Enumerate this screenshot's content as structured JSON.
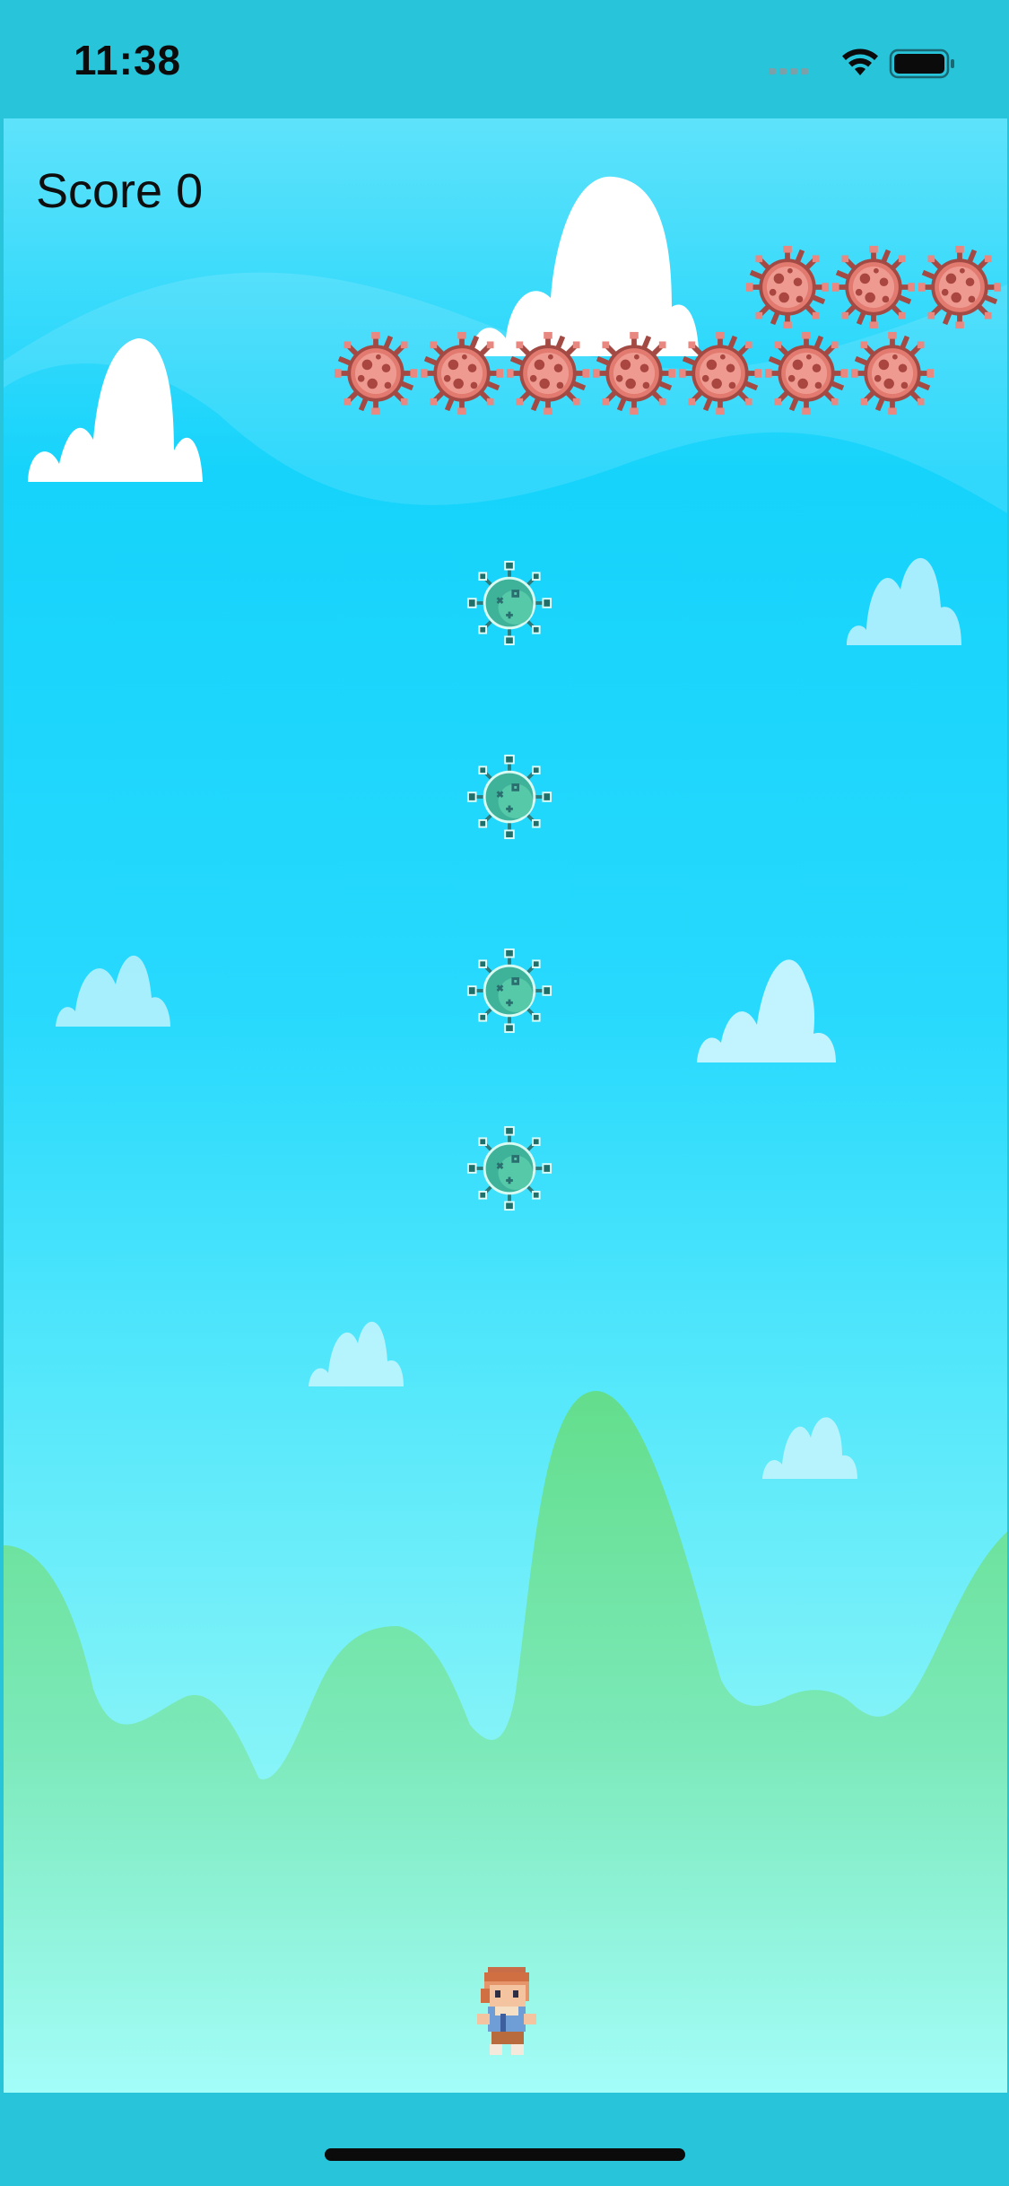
{
  "status_bar": {
    "time": "11:38",
    "icons": [
      "cellular-signal-icon",
      "wifi-icon",
      "battery-icon"
    ]
  },
  "game": {
    "score_text": "Score 0",
    "enemies": {
      "sprite": "red-virus-icon",
      "color": "#e27a70",
      "rows": [
        3,
        7
      ]
    },
    "projectiles": {
      "sprite": "green-virus-icon",
      "color": "#3fb39a",
      "count": 4
    },
    "player": {
      "sprite": "pixel-character-icon"
    },
    "colors": {
      "sky_top": "#5ee2fb",
      "sky_bottom": "#a3fdf9",
      "hills": "#6ee49e",
      "frame": "#27c4da"
    }
  }
}
